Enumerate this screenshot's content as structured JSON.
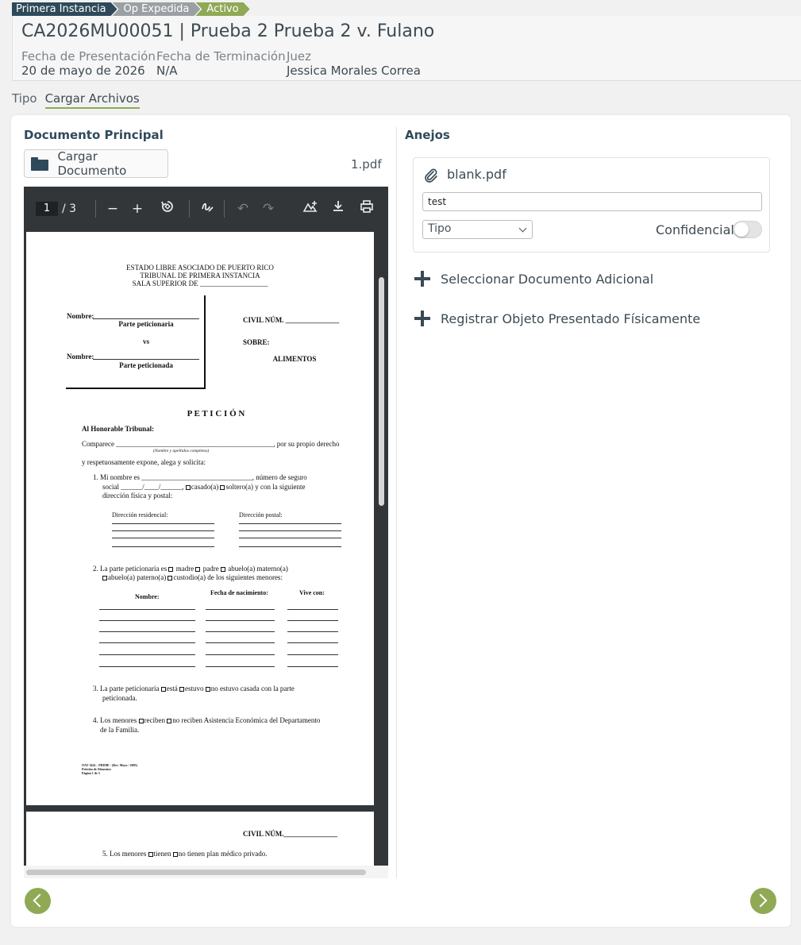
{
  "breadcrumb": [
    "Primera Instancia",
    "Op Expedida",
    "Activo"
  ],
  "case": {
    "title": "CA2026MU00051 | Prueba 2 Prueba 2 v. Fulano",
    "fecha_presentacion_label": "Fecha de Presentación",
    "fecha_presentacion": "20 de mayo de 2026",
    "fecha_terminacion_label": "Fecha de Terminación",
    "fecha_terminacion": "N/A",
    "juez_label": "Juez",
    "juez": "Jessica Morales Correa"
  },
  "tabs": [
    {
      "label": "Tipo",
      "active": false
    },
    {
      "label": "Cargar Archivos",
      "active": true
    }
  ],
  "principal": {
    "title": "Documento Principal",
    "upload_label": "Cargar Documento",
    "filename": "1.pdf"
  },
  "viewer": {
    "page_current": "1",
    "page_total": "/ 3"
  },
  "pdf": {
    "header_1": "ESTADO LIBRE ASOCIADO DE PUERTO RICO",
    "header_2": "TRIBUNAL DE PRIMERA INSTANCIA",
    "header_3": "SALA SUPERIOR DE ___________________",
    "nombre_1": "Nombre:",
    "parte_1": "Parte peticionaria",
    "vs": "vs",
    "nombre_2": "Nombre:",
    "parte_2": "Parte peticionada",
    "civil": "CIVIL  NÚM. _______________",
    "sobre": "SOBRE:",
    "alimentos": "ALIMENTOS",
    "peticion": "P E T I C I Ó N",
    "honorable": "Al Honorable Tribunal:",
    "comparece": "Comparece ____________________________________________, por su propio derecho",
    "nombre_apellidos": "(Nombre y apellidos completos)",
    "expone": "y respetuosamente expone, alega y solicita:",
    "item1a": "1.   Mi nombre es _______________________________, número de seguro",
    "item1b_pre": "social ______/____/______,",
    "item1b_casado": "casado(a)",
    "item1b_soltero": "soltero(a)",
    "item1b_post": "y con la siguiente",
    "item1c": "dirección física y postal:",
    "dir_res": "Dirección residencial:",
    "dir_post": "Dirección postal:",
    "item2a": "2.  La parte peticionaria es",
    "madre": "madre",
    "padre": "padre",
    "abuelo_m": "abuelo(a) materno(a)",
    "abuelo_p": "abuelo(a) paterno(a)",
    "custodio": "custodio(a) de los siguientes menores:",
    "col_nombre": "Nombre:",
    "col_fecha": "Fecha de nacimiento:",
    "col_vive": "Vive con:",
    "item3a_pre": "3.  La parte peticionaria",
    "esta": "está",
    "estuvo": "estuvo",
    "no_estuvo": "no estuvo casada con la parte",
    "item3b": "peticionada.",
    "item4a_pre": "4. Los menores",
    "reciben": "reciben",
    "no_reciben": "no reciben Asistencia Económica del Departamento",
    "item4b": "de la Familia.",
    "footer_1": "OAT 1424 – PRIME - (Rev. Mayo / 2005)",
    "footer_2": "Petición de Alimentos",
    "footer_3": "Página 1 de 3",
    "p2_civil": "CIVIL NÚM._______________",
    "p2_item5_pre": "5.  Los menores",
    "p2_tienen": "tienen",
    "p2_no_tienen": "no tienen plan médico privado."
  },
  "anejos": {
    "title": "Anejos",
    "attachment_name": "blank.pdf",
    "description_value": "test",
    "tipo_placeholder": "Tipo",
    "confidencial_label": "Confidencial",
    "confidencial_on": false,
    "add_document_label": "Seleccionar Documento Adicional",
    "register_object_label": "Registrar Objeto Presentado Físicamente"
  },
  "colors": {
    "accent_green": "#8fa955",
    "brand_dark": "#2e4a5a",
    "viewer_toolbar": "#323639"
  }
}
